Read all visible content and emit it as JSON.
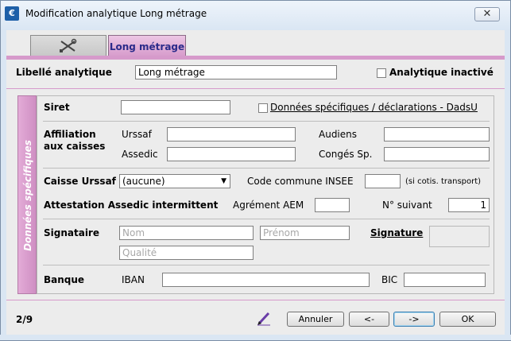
{
  "window": {
    "title": "Modification analytique Long métrage",
    "app_icon": "€",
    "close_label": "✕"
  },
  "tabs": [
    {
      "icon": "tools-icon"
    },
    {
      "label": "Long métrage"
    }
  ],
  "header": {
    "libelle_label": "Libellé analytique",
    "libelle_value": "Long métrage",
    "inactive_label": "Analytique inactivé"
  },
  "side_tab": {
    "label": "Données spécifiques"
  },
  "form": {
    "siret_label": "Siret",
    "siret_value": "",
    "dadsu_label": "Données spécifiques / déclarations - DadsU",
    "affiliation_label_1": "Affiliation",
    "affiliation_label_2": "aux caisses",
    "urssaf_label": "Urssaf",
    "assedic_label": "Assedic",
    "audiens_label": "Audiens",
    "conges_label": "Congés Sp.",
    "caisse_label": "Caisse Urssaf",
    "caisse_value": "(aucune)",
    "code_commune_label": "Code commune INSEE",
    "code_commune_note": "(si cotis. transport)",
    "attestation_label": "Attestation Assedic intermittent",
    "agrement_label": "Agrément AEM",
    "num_suivant_label": "N° suivant",
    "num_suivant_value": "1",
    "signataire_label": "Signataire",
    "nom_placeholder": "Nom",
    "prenom_placeholder": "Prénom",
    "qualite_placeholder": "Qualité",
    "signature_label": "Signature",
    "banque_label": "Banque",
    "iban_label": "IBAN",
    "bic_label": "BIC"
  },
  "footer": {
    "page_indicator": "2/9",
    "annuler_label": "Annuler",
    "prev_label": "<-",
    "next_label": "->",
    "ok_label": "OK"
  },
  "colors": {
    "accent_pink": "#d69acb",
    "tab_text": "#2b2b8a"
  }
}
